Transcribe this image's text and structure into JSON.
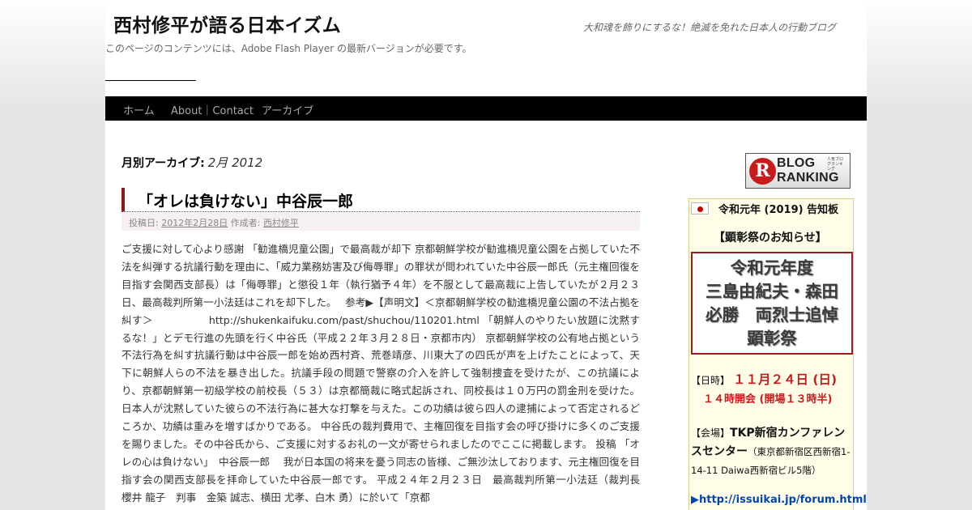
{
  "header": {
    "site_title": "西村修平が語る日本イズム",
    "site_description": "大和魂を飾りにするな！絶滅を免れた日本人の行動ブログ",
    "flash_notice": "このページのコンテンツには、Adobe Flash Player の最新バージョンが必要です。"
  },
  "nav": {
    "items": [
      {
        "label": "ホーム"
      },
      {
        "label": "About｜Contact"
      },
      {
        "label": "アーカイブ"
      }
    ]
  },
  "archive": {
    "label": "月別アーカイブ:",
    "month": "2月 2012"
  },
  "post": {
    "title": "「オレは負けない」中谷辰一郎",
    "meta_posted_label": "投稿日:",
    "meta_date": "2012年2月28日",
    "meta_author_label": "作成者:",
    "meta_author": "西村修平",
    "body": "ご支援に対して心より感謝 「勧進橋児童公園」で最高裁が却下 京都朝鮮学校が勧進橋児童公園を占拠していた不法を糾弾する抗議行動を理由に、「威力業務妨害及び侮辱罪」の罪状が問われていた中谷辰一郎氏（元主権回復を目指す会関西支部長）は「侮辱罪」と懲役１年（執行猶予４年）を不服として最高裁に上告していたが２月２３日、最高裁判所第一小法廷はこれを却下した。　 参考▶【声明文】＜京都朝鮮学校の勧進橋児童公園の不法占拠を糾す＞　　　　　 http://shukenkaifuku.com/past/shuchou/110201.html 「朝鮮人のやりたい放題に沈黙するな！」とデモ行進の先頭を行く中谷氏（平成２２年３月２８日・京都市内） 京都朝鮮学校の公有地占拠という不法行為を糾す抗議行動は中谷辰一郎を始め西村斉、荒巻靖彦、川東大了の四氏が声を上げたことによって、天下に朝鮮人らの不法を暴き出した。抗議手段の問題で警察の介入を許して強制捜査を受けたが、この抗議により、京都朝鮮第一初級学校の前校長（５３）は京都簡裁に略式起訴され、同校長は１０万円の罰金刑を受けた。日本人が沈黙していた彼らの不法行為に甚大な打撃を与えた。この功績は彼ら四人の逮捕によって否定されるどころか、功績は重みを増すばかりである。 中谷氏の裁判費用で、主権回復を目指す会の呼び掛けに多くのご支援を賜りました。その中谷氏から、ご支援に対するお礼の一文が寄せられましたのでここに掲載します。 投稿 「オレの心は負けない」　中谷辰一郎　 我が日本国の将来を憂う同志の皆様、ご無沙汰しております、元主権回復を目指す会の関西支部長を拝命していた中谷辰一郎です。 平成２４年２月２３日　最高裁判所第一小法廷（裁判長　櫻井 龍子　判事　金築 誠志、横田 尤孝、白木 勇）に於いて「京都"
  },
  "sidebar": {
    "ranking_banner": {
      "logo_letter": "R",
      "line1": "BLOG",
      "line2": "RANKING",
      "small": "人気ブログランキング"
    },
    "notice": {
      "flag_icon": "japan-flag-icon",
      "title": "令和元年 (2019) 告知板",
      "subtitle": "【顕彰祭のお知らせ】",
      "event_lines": [
        "令和元年度",
        "三島由紀夫・森田",
        "必勝　両烈士追悼",
        "顕彰祭"
      ],
      "date_label": "【日時】",
      "date_value": "１１月２４日 (日)",
      "time_value": "１４時開会 (開場１３時半)",
      "venue_label": "【会場】",
      "venue_name": "TKP新宿カンファレンスセンター",
      "venue_address": "（東京都新宿区西新宿1-14-11 Daiwa西新宿ビル5階）",
      "link_arrow": "▶",
      "link_text": "http://issuikai.jp/forum.html"
    }
  }
}
